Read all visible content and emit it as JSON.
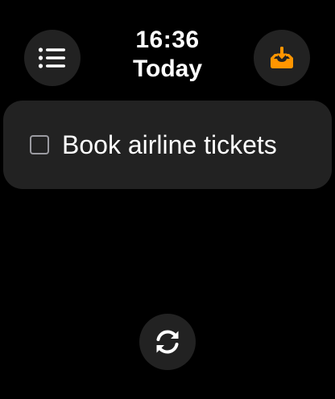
{
  "header": {
    "time": "16:36",
    "date": "Today"
  },
  "toolbar": {
    "menu_icon": "list-icon",
    "inbox_icon": "inbox-download-icon",
    "sync_icon": "sync-arrows-icon"
  },
  "tasks": [
    {
      "label": "Book airline tickets",
      "checked": false
    }
  ],
  "colors": {
    "background": "#000000",
    "surface": "#222222",
    "accent": "#ff9500",
    "checkbox_border": "#9b9ba1",
    "text": "#ffffff"
  }
}
